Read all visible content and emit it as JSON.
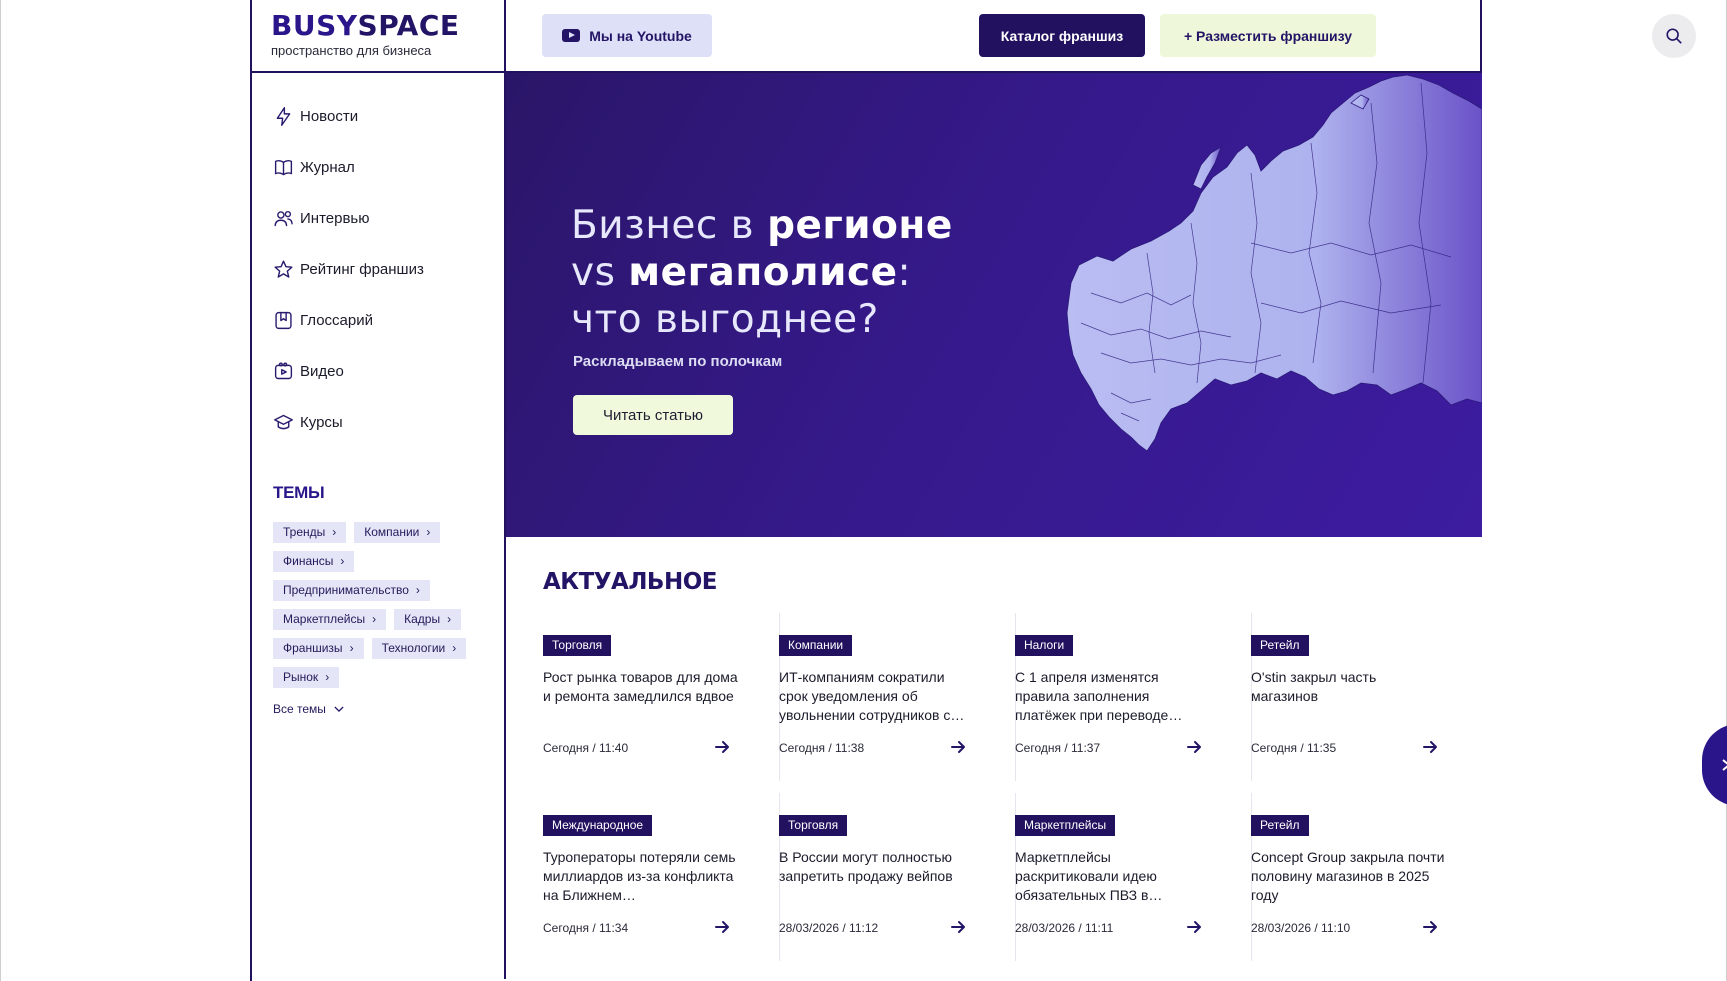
{
  "logo": {
    "part1": "BUSY",
    "part2": "SPACE",
    "tagline": "пространство для бизнеса"
  },
  "nav": {
    "items": [
      {
        "label": "Новости",
        "icon": "lightning-icon"
      },
      {
        "label": "Журнал",
        "icon": "book-icon"
      },
      {
        "label": "Интервью",
        "icon": "people-icon"
      },
      {
        "label": "Рейтинг франшиз",
        "icon": "star-icon"
      },
      {
        "label": "Глоссарий",
        "icon": "bookmark-icon"
      },
      {
        "label": "Видео",
        "icon": "video-icon"
      },
      {
        "label": "Курсы",
        "icon": "graduation-cap-icon"
      }
    ]
  },
  "topics": {
    "title": "ТЕМЫ",
    "tags": [
      "Тренды",
      "Компании",
      "Финансы",
      "Предпринимательство",
      "Маркетплейсы",
      "Кадры",
      "Франшизы",
      "Технологии",
      "Рынок"
    ],
    "all_label": "Все темы"
  },
  "header": {
    "youtube_label": "Мы на Youtube",
    "catalog_label": "Каталог франшиз",
    "place_label": "+ Разместить франшизу"
  },
  "hero": {
    "title_line1_regular": "Бизнес в ",
    "title_line1_bold": "регионе",
    "title_line2_regular": "vs ",
    "title_line2_bold": "мегаполисе",
    "title_line2_suffix": ":",
    "title_line3": "что выгоднее?",
    "subtitle": "Раскладываем по полочкам",
    "button_label": "Читать статью"
  },
  "actual": {
    "title": "АКТУАЛЬНОЕ",
    "cards": [
      {
        "tag": "Торговля",
        "title": "Рост рынка товаров для дома и ремонта замедлился вдвое",
        "date": "Сегодня / 11:40"
      },
      {
        "tag": "Компании",
        "title": "ИТ-компаниям сократили срок уведомления об увольнении сотрудников с…",
        "date": "Сегодня / 11:38"
      },
      {
        "tag": "Налоги",
        "title": "С 1 апреля изменятся правила заполнения платёжек при переводе…",
        "date": "Сегодня / 11:37"
      },
      {
        "tag": "Ретейл",
        "title": "O'stin закрыл часть магазинов",
        "date": "Сегодня / 11:35"
      },
      {
        "tag": "Международное",
        "title": "Туроператоры потеряли семь миллиардов из-за конфликта на Ближнем…",
        "date": "Сегодня / 11:34"
      },
      {
        "tag": "Торговля",
        "title": "В России могут полностью запретить продажу вейпов",
        "date": "28/03/2026 / 11:12"
      },
      {
        "tag": "Маркетплейсы",
        "title": "Маркетплейсы раскритиковали идею обязательных ПВЗ в…",
        "date": "28/03/2026 / 11:11"
      },
      {
        "tag": "Ретейл",
        "title": "Concept Group закрыла почти половину магазинов в 2025 году",
        "date": "28/03/2026 / 11:10"
      }
    ]
  },
  "colors": {
    "brand": "#21115f",
    "accent": "#2a168a",
    "tag_bg": "#e4e6f7",
    "cta_bg": "#f1f9dc"
  }
}
